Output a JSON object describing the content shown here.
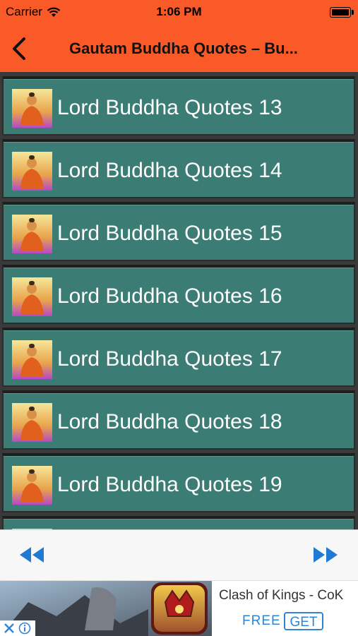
{
  "status_bar": {
    "carrier": "Carrier",
    "time": "1:06 PM"
  },
  "nav": {
    "title": "Gautam Buddha Quotes – Bu...",
    "back_icon": "chevron-left-icon"
  },
  "list": {
    "items": [
      {
        "label": "Lord Buddha Quotes 13"
      },
      {
        "label": "Lord Buddha Quotes 14"
      },
      {
        "label": "Lord Buddha Quotes 15"
      },
      {
        "label": "Lord Buddha Quotes 16"
      },
      {
        "label": "Lord Buddha Quotes 17"
      },
      {
        "label": "Lord Buddha Quotes 18"
      },
      {
        "label": "Lord Buddha Quotes 19"
      }
    ]
  },
  "toolbar": {
    "rewind_icon": "rewind-icon",
    "forward_icon": "fast-forward-icon"
  },
  "ad": {
    "title": "Clash of Kings - CoK",
    "free_label": "FREE",
    "get_label": "GET"
  },
  "colors": {
    "accent": "#fa5a28",
    "row": "#3b7d74",
    "link": "#2f84d6"
  }
}
